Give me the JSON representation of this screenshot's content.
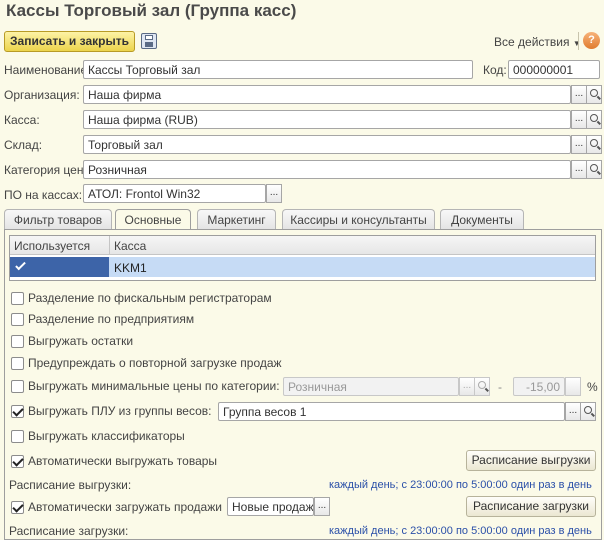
{
  "window": {
    "title": "Кассы Торговый зал (Группа касс)"
  },
  "toolbar": {
    "save_close": "Записать и закрыть",
    "all_actions": "Все действия",
    "help": "?"
  },
  "form": {
    "name_label": "Наименование:",
    "name_value": "Кассы Торговый зал",
    "code_label": "Код:",
    "code_value": "000000001",
    "org_label": "Организация:",
    "org_value": "Наша фирма",
    "cash_label": "Касса:",
    "cash_value": "Наша фирма (RUB)",
    "warehouse_label": "Склад:",
    "warehouse_value": "Торговый зал",
    "price_label": "Категория цен:",
    "price_value": "Розничная",
    "po_label": "ПО на кассах:",
    "po_value": "АТОЛ: Frontol Win32",
    "ellipsis": "..."
  },
  "tabs": [
    {
      "label": "Фильтр товаров"
    },
    {
      "label": "Основные"
    },
    {
      "label": "Маркетинг"
    },
    {
      "label": "Кассиры и консультанты"
    },
    {
      "label": "Документы"
    }
  ],
  "table": {
    "headers": [
      "Используется",
      "Касса"
    ],
    "rows": [
      {
        "used": true,
        "name": "KKM1"
      }
    ]
  },
  "options": {
    "split_fiscal": "Разделение по фискальным регистраторам",
    "split_enterprise": "Разделение по предприятиям",
    "export_stock": "Выгружать остатки",
    "warn_reload": "Предупреждать о повторной загрузке продаж",
    "export_min_prices": "Выгружать минимальные цены по категории:",
    "min_price_category": "Розничная",
    "min_price_value": "-15,00",
    "percent": "%",
    "export_plu": "Выгружать ПЛУ из группы весов:",
    "plu_group": "Группа весов 1",
    "export_classifiers": "Выгружать классификаторы",
    "auto_export": "Автоматически выгружать товары",
    "export_schedule_btn": "Расписание выгрузки",
    "export_schedule_label": "Расписание выгрузки:",
    "export_schedule_link": "каждый  день; с 23:00:00 по 5:00:00 один раз в день",
    "auto_import": "Автоматически загружать продажи",
    "import_mode": "Новые продажи",
    "import_schedule_btn": "Расписание загрузки",
    "import_schedule_label": "Расписание загрузки:",
    "import_schedule_link": "каждый  день; с 23:00:00 по 5:00:00 один раз в день"
  },
  "colors": {
    "accent_title": "#4a4a4a",
    "link": "#2a4fa8",
    "selection": "#c6dbf5",
    "primary_button": "#ecd44c"
  }
}
